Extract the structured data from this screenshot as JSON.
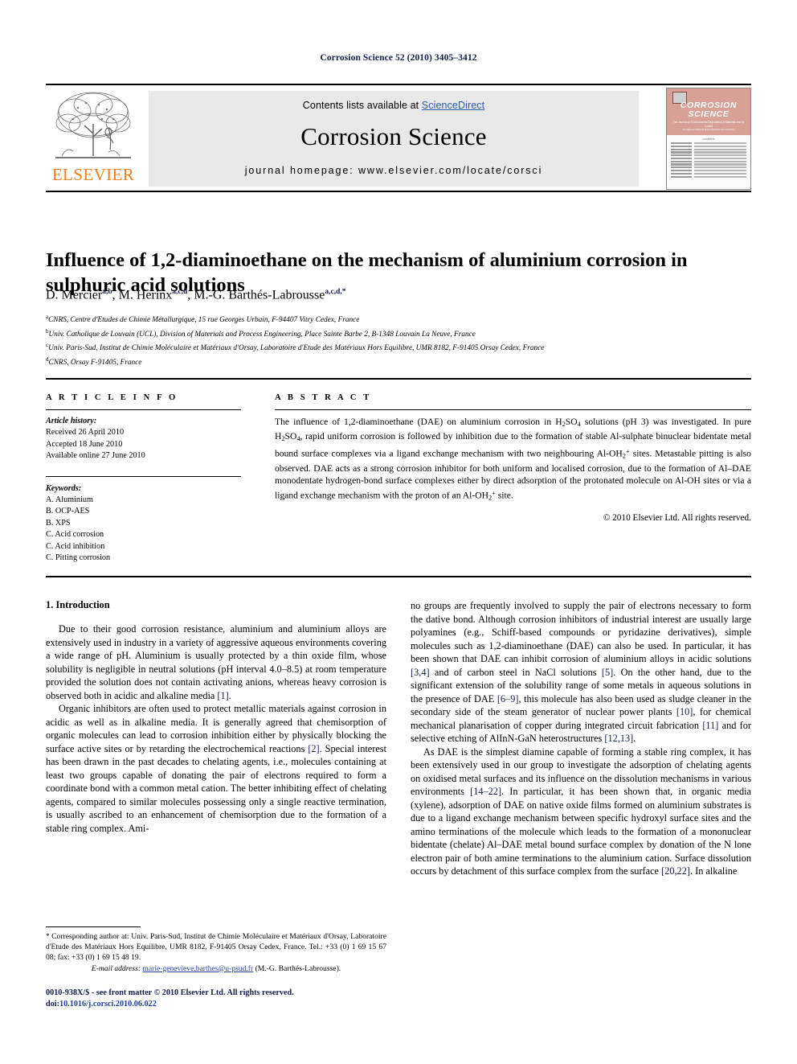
{
  "running_head": "Corrosion Science 52 (2010) 3405–3412",
  "masthead": {
    "publisher_name": "ELSEVIER",
    "contents_prefix": "Contents lists available at ",
    "contents_link": "ScienceDirect",
    "journal_name": "Corrosion Science",
    "homepage": "journal homepage: www.elsevier.com/locate/corsci",
    "cover": {
      "title_line1": "CORROSION",
      "title_line2": "SCIENCE",
      "subtitle": "The Journal on Environmental Degradation of Materials and its Control",
      "subtitle2": "An Official Journal of the Institute of Corrosion",
      "contents_label": "CONTENTS"
    }
  },
  "article": {
    "title": "Influence of 1,2-diaminoethane on the mechanism of aluminium corrosion in sulphuric acid solutions",
    "authors": [
      {
        "name": "D. Mercier",
        "affil": "a,b"
      },
      {
        "name": "M. Herinx",
        "affil": "a,c,d"
      },
      {
        "name": "M.-G. Barthés-Labrousse",
        "affil": "a,c,d,*"
      }
    ],
    "affiliations": [
      {
        "mark": "a",
        "text": "CNRS, Centre d'Etudes de Chimie Métallurgique, 15 rue Georges Urbain, F-94407 Vitry Cedex, France"
      },
      {
        "mark": "b",
        "text": "Univ. Catholique de Louvain (UCL), Division of Materials and Process Engineering, Place Sainte Barbe 2, B-1348 Louvain La Neuve, France"
      },
      {
        "mark": "c",
        "text": "Univ. Paris-Sud, Institut de Chimie Moléculaire et Matériaux d'Orsay, Laboratoire d'Etude des Matériaux Hors Equilibre, UMR 8182, F-91405 Orsay Cedex, France"
      },
      {
        "mark": "d",
        "text": "CNRS, Orsay F-91405, France"
      }
    ]
  },
  "article_info": {
    "heading": "A R T I C L E    I N F O",
    "history_label": "Article history:",
    "history": [
      "Received 26 April 2010",
      "Accepted 18 June 2010",
      "Available online 27 June 2010"
    ],
    "keywords_label": "Keywords:",
    "keywords": [
      "A. Aluminium",
      "B. OCP-AES",
      "B. XPS",
      "C. Acid corrosion",
      "C. Acid inhibition",
      "C. Pitting corrosion"
    ]
  },
  "abstract": {
    "heading": "A B S T R A C T",
    "paragraph_html": "The influence of 1,2-diaminoethane (DAE) on aluminium corrosion in H<sub>2</sub>SO<sub>4</sub> solutions (pH 3) was investigated. In pure H<sub>2</sub>SO<sub>4</sub>, rapid uniform corrosion is followed by inhibition due to the formation of stable Al-sulphate binuclear bidentate metal bound surface complexes via a ligand exchange mechanism with two neighbouring Al-OH<sub>2</sub><sup class=\"chg\">+</sup> sites. Metastable pitting is also observed. DAE acts as a strong corrosion inhibitor for both uniform and localised corrosion, due to the formation of Al–DAE monodentate hydrogen-bond surface complexes either by direct adsorption of the protonated molecule on Al-OH sites or via a ligand exchange mechanism with the proton of an Al-OH<sub>2</sub><sup class=\"chg\">+</sup> site.",
    "copyright": "© 2010 Elsevier Ltd. All rights reserved."
  },
  "body": {
    "section_number_title": "1. Introduction",
    "left_paragraphs_html": [
      "Due to their good corrosion resistance, aluminium and aluminium alloys are extensively used in industry in a variety of aggressive aqueous environments covering a wide range of pH. Aluminium is usually protected by a thin oxide film, whose solubility is negligible in neutral solutions (pH interval 4.0–8.5) at room temperature provided the solution does not contain activating anions, whereas heavy corrosion is observed both in acidic and alkaline media <span class=\"ref\">[1]</span>.",
      "Organic inhibitors are often used to protect metallic materials against corrosion in acidic as well as in alkaline media. It is generally agreed that chemisorption of organic molecules can lead to corrosion inhibition either by physically blocking the surface active sites or by retarding the electrochemical reactions <span class=\"ref\">[2]</span>. Special interest has been drawn in the past decades to chelating agents, i.e., molecules containing at least two groups capable of donating the pair of electrons required to form a coordinate bond with a common metal cation. The better inhibiting effect of chelating agents, compared to similar molecules possessing only a single reactive termination, is usually ascribed to an enhancement of chemisorption due to the formation of a stable ring complex. Ami-"
    ],
    "right_paragraphs_html": [
      "no groups are frequently involved to supply the pair of electrons necessary to form the dative bond. Although corrosion inhibitors of industrial interest are usually large polyamines (e.g., Schiff-based compounds or pyridazine derivatives), simple molecules such as 1,2-diaminoethane (DAE) can also be used. In particular, it has been shown that DAE can inhibit corrosion of aluminium alloys in acidic solutions <span class=\"ref\">[3,4]</span> and of carbon steel in NaCl solutions <span class=\"ref\">[5]</span>. On the other hand, due to the significant extension of the solubility range of some metals in aqueous solutions in the presence of DAE <span class=\"ref\">[6–9]</span>, this molecule has also been used as sludge cleaner in the secondary side of the steam generator of nuclear power plants <span class=\"ref\">[10]</span>, for chemical mechanical planarisation of copper during integrated circuit fabrication <span class=\"ref\">[11]</span> and for selective etching of AlInN-GaN heterostructures <span class=\"ref\">[12,13]</span>.",
      "As DAE is the simplest diamine capable of forming a stable ring complex, it has been extensively used in our group to investigate the adsorption of chelating agents on oxidised metal surfaces and its influence on the dissolution mechanisms in various environments <span class=\"ref\">[14–22]</span>. In particular, it has been shown that, in organic media (xylene), adsorption of DAE on native oxide films formed on aluminium substrates is due to a ligand exchange mechanism between specific hydroxyl surface sites and the amino terminations of the molecule which leads to the formation of a mononuclear bidentate (chelate) Al–DAE metal bound surface complex by donation of the N lone electron pair of both amine terminations to the aluminium cation. Surface dissolution occurs by detachment of this surface complex from the surface <span class=\"ref\">[20,22]</span>. In alkaline"
    ]
  },
  "footnote": {
    "corresponding_html": "<span class=\"star\">*</span> Corresponding author at: Univ. Paris-Sud, Institut de Chimie Moléculaire et Matériaux d'Orsay, Laboratoire d'Etude des Matériaux Hors Equilibre, UMR 8182, F-91405 Orsay Cedex, France. Tel.: +33 (0) 1 69 15 67 08; fax: +33 (0) 1 69 15 48 19.",
    "email_label": "E-mail address:",
    "email_address": "marie-genevieve.barthes@u-psud.fr",
    "email_owner": "(M.-G. Barthés-Labrousse)."
  },
  "imprint": {
    "line1": "0010-938X/$ - see front matter © 2010 Elsevier Ltd. All rights reserved.",
    "doi_label": "doi:",
    "doi_value": "10.1016/j.corsci.2010.06.022"
  },
  "colors": {
    "link": "#2a5caa",
    "reference": "#141b4d",
    "elsevier_orange": "#f07c1a",
    "cover_salmon": "#d9a196",
    "band_grey": "#e8e8e8"
  }
}
